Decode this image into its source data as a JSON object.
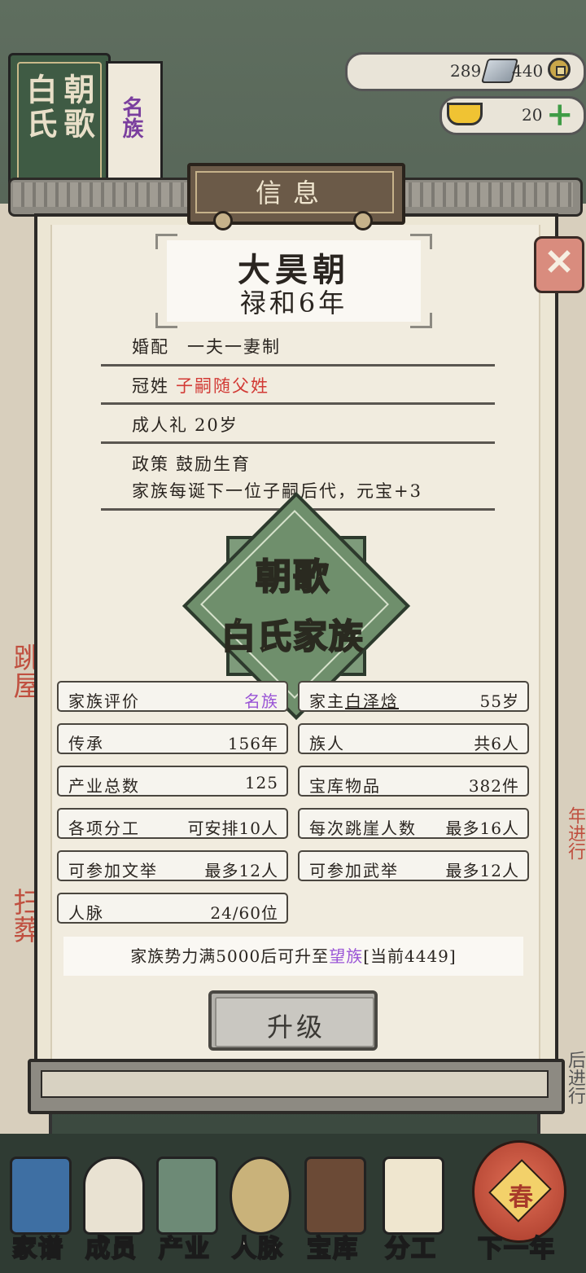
{
  "family_book": {
    "col_right": "朝歌",
    "col_left": "白氏",
    "rank": "名族"
  },
  "resources": {
    "silver": "289",
    "copper": "440",
    "gold": "20"
  },
  "dialog": {
    "title": "信息",
    "dynasty": "大昊朝",
    "year": "禄和6年",
    "rules": {
      "marriage_label": "婚配",
      "marriage_value": "一夫一妻制",
      "surname_label": "冠姓",
      "surname_value": "子嗣随父姓",
      "coming_of_age_label": "成人礼",
      "coming_of_age_value": "20岁",
      "policy_label": "政策",
      "policy_value": "鼓励生育",
      "policy_desc": "家族每诞下一位子嗣后代，元宝+3"
    },
    "emblem": {
      "line1": "朝歌",
      "line2": "白氏家族"
    },
    "stats": {
      "rating_label": "家族评价",
      "rating_value": "名族",
      "head_label": "家主",
      "head_name": "白泽焓",
      "head_age": "55岁",
      "heritage_label": "传承",
      "heritage_value": "156年",
      "members_label": "族人",
      "members_value": "共6人",
      "industry_label": "产业总数",
      "industry_value": "125",
      "treasury_label": "宝库物品",
      "treasury_value": "382件",
      "labor_label": "各项分工",
      "labor_value": "可安排10人",
      "cliff_label": "每次跳崖人数",
      "cliff_value": "最多16人",
      "civil_exam_label": "可参加文举",
      "civil_exam_value": "最多12人",
      "military_exam_label": "可参加武举",
      "military_exam_value": "最多12人",
      "network_label": "人脉",
      "network_value": "24/60位"
    },
    "upgrade_info": {
      "prefix": "家族势力满5000后可升至",
      "target": "望族",
      "current": "[当前4449]"
    },
    "upgrade_button": "升级"
  },
  "side": {
    "left_top": "跳屋",
    "left_bottom": "扫葬",
    "right_mid": "年进行",
    "right_low": "后进行"
  },
  "nav": {
    "genealogy": "家谱",
    "members": "成员",
    "industry": "产业",
    "network": "人脉",
    "treasury": "宝库",
    "labor": "分工",
    "next_year": "下一年",
    "lantern_char": "春"
  }
}
